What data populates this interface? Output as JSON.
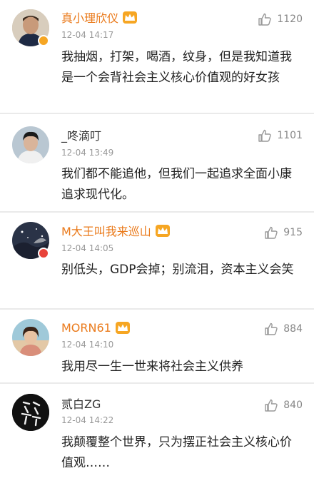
{
  "colors": {
    "name_vip": "#ea7a1b",
    "name_plain": "#333333",
    "time": "#999999",
    "text": "#222222",
    "like": "#888888"
  },
  "comments": [
    {
      "username": "真小理欣仪",
      "vip": true,
      "verified": "orange",
      "time": "12-04 14:17",
      "likes": "1120",
      "text": "我抽烟，打架，喝酒，纹身，但是我知道我是一个会背社会主义核心价值观的好女孩",
      "avatar_icon": "avatar-soccer-player"
    },
    {
      "username": "_咚滴叮",
      "vip": false,
      "time": "12-04 13:49",
      "likes": "1101",
      "text": "我们都不能追他，但我们一起追求全面小康追求现代化。",
      "avatar_icon": "avatar-young-man"
    },
    {
      "username": "M大王叫我来巡山",
      "vip": true,
      "verified": "red",
      "time": "12-04 14:05",
      "likes": "915",
      "text": "别低头，GDP会掉；别流泪，资本主义会笑",
      "avatar_icon": "avatar-night-sky"
    },
    {
      "username": "MORN61",
      "vip": true,
      "time": "12-04 14:10",
      "likes": "884",
      "text": "我用尽一生一世来将社会主义供养",
      "avatar_icon": "avatar-girl"
    },
    {
      "username": "贰白ZG",
      "vip": false,
      "time": "12-04 14:22",
      "likes": "840",
      "text": "我颠覆整个世界，只为摆正社会主义核心价值观……",
      "avatar_icon": "avatar-calligraphy"
    }
  ]
}
